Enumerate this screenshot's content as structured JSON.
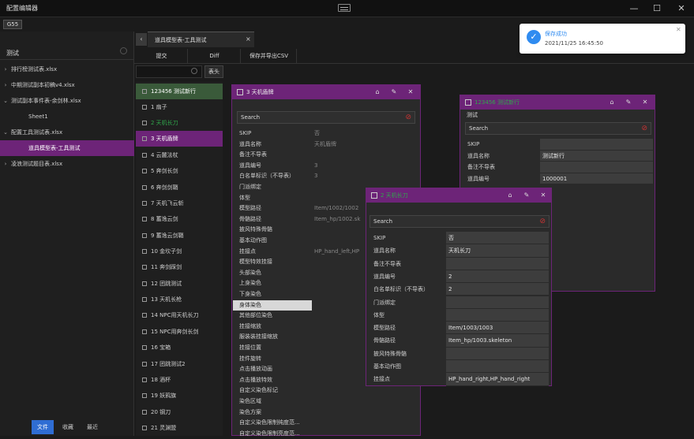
{
  "app": {
    "title": "配置编辑器",
    "project_tab": "G55"
  },
  "window_controls": {
    "minimize": "—",
    "maximize": "☐",
    "close": "✕"
  },
  "left": {
    "search": "测试",
    "tree": [
      {
        "label": "排行榜测试表.xlsx",
        "chev": "›"
      },
      {
        "label": "中期测试副本初稿v4.xlsx",
        "chev": "›"
      },
      {
        "label": "测试副本事件表-余剑林.xlsx",
        "chev": "⌄"
      },
      {
        "label": "Sheet1",
        "chev": ""
      },
      {
        "label": "配置工具测试表.xlsx",
        "chev": "⌄"
      },
      {
        "label": "道具模型表-工具测试",
        "chev": ""
      },
      {
        "label": "凌浪测试题目表.xlsx",
        "chev": "›"
      }
    ],
    "buttons": {
      "file": "文件",
      "fav": "收藏",
      "recent": "最近"
    }
  },
  "tab": {
    "back": "‹",
    "label": "道具模型表-工具测试",
    "close": "×"
  },
  "toolbar": {
    "submit": "提交",
    "diff": "Diff",
    "save_export": "保存并导出CSV"
  },
  "mid": {
    "col_btn": "表头",
    "items": [
      {
        "id": "1",
        "name": "1 扇子"
      },
      {
        "id": "2",
        "name": "2 天机长刀"
      },
      {
        "id": "3",
        "name": "3 天机盾牌"
      },
      {
        "id": "4",
        "name": "4 云麓法杖"
      },
      {
        "id": "5",
        "name": "5 奔剑长剑"
      },
      {
        "id": "6",
        "name": "6 奔剑剑鞘"
      },
      {
        "id": "7",
        "name": "7 天机飞云斩"
      },
      {
        "id": "8",
        "name": "8 蓄逸云剑"
      },
      {
        "id": "9",
        "name": "9 蓄逸云剑鞘"
      },
      {
        "id": "10",
        "name": "10 金坎子剑"
      },
      {
        "id": "11",
        "name": "11 奔剑踩剑"
      },
      {
        "id": "12",
        "name": "12 团跳测试"
      },
      {
        "id": "13",
        "name": "13 天机长枪"
      },
      {
        "id": "14",
        "name": "14 NPC用天机长刀"
      },
      {
        "id": "15",
        "name": "15 NPC用奔剑长剑"
      },
      {
        "id": "16",
        "name": "16 宝箱"
      },
      {
        "id": "17",
        "name": "17 团跳测试2"
      },
      {
        "id": "18",
        "name": "18 酒杯"
      },
      {
        "id": "19",
        "name": "19 妖鸦旗"
      },
      {
        "id": "20",
        "name": "20 钢刀"
      },
      {
        "id": "21",
        "name": "21 灵渊盟"
      }
    ]
  },
  "win_a": {
    "title": "3 天机盾牌",
    "search": "Search",
    "rows": [
      {
        "label": "SKIP",
        "value": "否"
      },
      {
        "label": "道具名称",
        "value": "天机盾牌"
      },
      {
        "label": "备注不导表",
        "value": ""
      },
      {
        "label": "道具编号",
        "value": "3"
      },
      {
        "label": "白名单标识（不导表）",
        "value": "3"
      },
      {
        "label": "门派绑定",
        "value": ""
      },
      {
        "label": "体型",
        "value": ""
      },
      {
        "label": "模型路径",
        "value": "Item/1002/1002"
      },
      {
        "label": "骨骼路径",
        "value": "Item_hp/1002.sk"
      },
      {
        "label": "披风特殊骨骼",
        "value": ""
      },
      {
        "label": "基本动作图",
        "value": ""
      },
      {
        "label": "挂接点",
        "value": "HP_hand_left,HP"
      },
      {
        "label": "模型特效挂接",
        "value": ""
      },
      {
        "label": "头部染色",
        "value": ""
      },
      {
        "label": "上身染色",
        "value": ""
      },
      {
        "label": "下身染色",
        "value": ""
      },
      {
        "label": "身体染色",
        "value": ""
      },
      {
        "label": "其他部位染色",
        "value": ""
      },
      {
        "label": "挂接缩放",
        "value": ""
      },
      {
        "label": "服装装挂接缩放",
        "value": ""
      },
      {
        "label": "挂接位置",
        "value": ""
      },
      {
        "label": "挂件旋转",
        "value": ""
      },
      {
        "label": "点击播放动画",
        "value": ""
      },
      {
        "label": "点击播放特效",
        "value": ""
      },
      {
        "label": "自定义染色标记",
        "value": ""
      },
      {
        "label": "染色区域",
        "value": ""
      },
      {
        "label": "染色方案",
        "value": ""
      },
      {
        "label": "自定义染色限制纯度范...",
        "value": ""
      },
      {
        "label": "自定义染色限制亮度范...",
        "value": ""
      }
    ]
  },
  "win_b": {
    "title": "2 天机长刀",
    "search": "Search",
    "rows": [
      {
        "label": "SKIP",
        "value": "否"
      },
      {
        "label": "道具名称",
        "value": "天机长刀"
      },
      {
        "label": "备注不导表",
        "value": ""
      },
      {
        "label": "道具编号",
        "value": "2"
      },
      {
        "label": "白名单标识（不导表）",
        "value": "2"
      },
      {
        "label": "门派绑定",
        "value": ""
      },
      {
        "label": "体型",
        "value": ""
      },
      {
        "label": "模型路径",
        "value": "Item/1003/1003"
      },
      {
        "label": "骨骼路径",
        "value": "Item_hp/1003.skeleton"
      },
      {
        "label": "披风特殊骨骼",
        "value": ""
      },
      {
        "label": "基本动作图",
        "value": ""
      },
      {
        "label": "挂接点",
        "value": "HP_hand_right,HP_hand_right"
      }
    ]
  },
  "win_c": {
    "title": "123456 测试新行",
    "subtitle": "测试",
    "search": "Search",
    "rows": [
      {
        "label": "SKIP",
        "value": ""
      },
      {
        "label": "道具名称",
        "value": "测试新行"
      },
      {
        "label": "备注不导表",
        "value": ""
      },
      {
        "label": "道具编号",
        "value": "1000001"
      }
    ]
  },
  "toast": {
    "icon": "✓",
    "title": "保存成功",
    "time": "2021/11/25 16:45:50",
    "close": "✕"
  },
  "colors": {
    "accent": "#6d2478",
    "primary_button": "#2f6dd3",
    "green_text": "#2fa84b"
  }
}
